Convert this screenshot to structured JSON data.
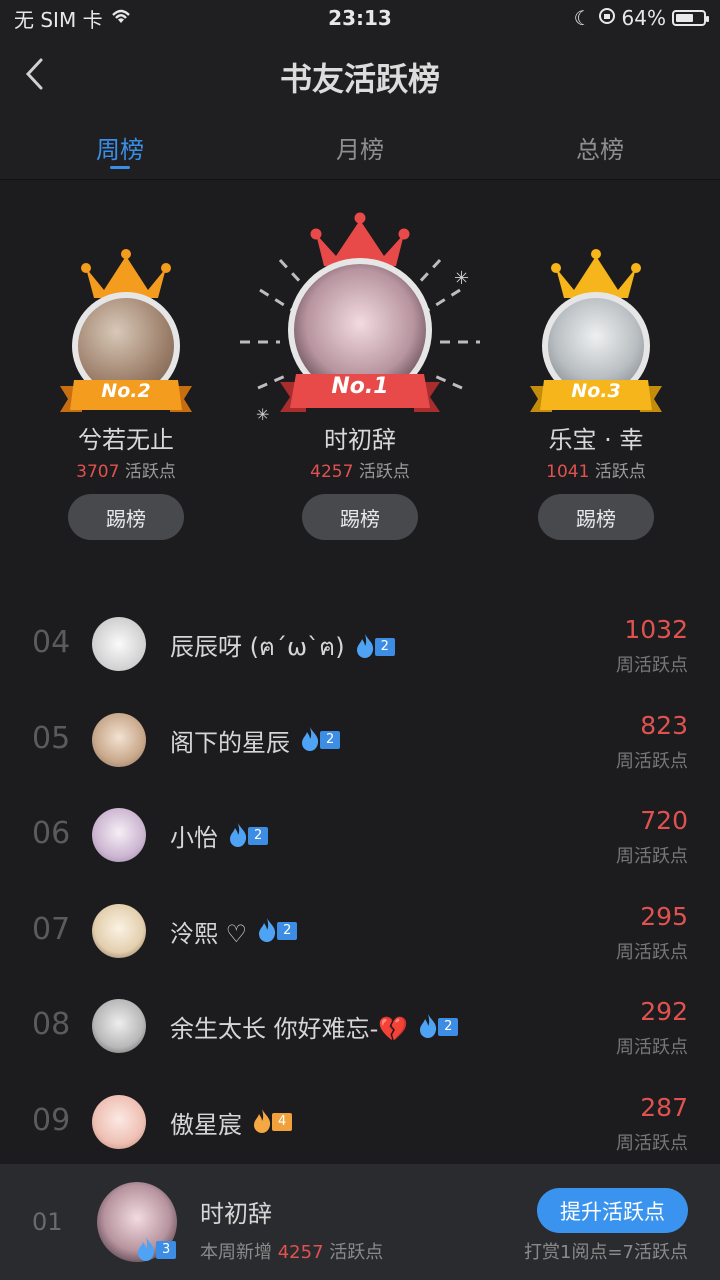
{
  "status_bar": {
    "carrier": "无 SIM 卡",
    "time": "23:13",
    "battery": "64%",
    "battery_level": 0.64
  },
  "nav": {
    "title": "书友活跃榜"
  },
  "tabs": [
    {
      "label": "周榜",
      "active": true
    },
    {
      "label": "月榜",
      "active": false
    },
    {
      "label": "总榜",
      "active": false
    }
  ],
  "podium": {
    "first": {
      "rank_label": "No.1",
      "name": "时初辞",
      "points": "4257",
      "points_unit": "活跃点",
      "button": "踢榜"
    },
    "second": {
      "rank_label": "No.2",
      "name": "兮若无止",
      "points": "3707",
      "points_unit": "活跃点",
      "button": "踢榜"
    },
    "third": {
      "rank_label": "No.3",
      "name": "乐宝 · 幸",
      "points": "1041",
      "points_unit": "活跃点",
      "button": "踢榜"
    }
  },
  "list": [
    {
      "rank": "04",
      "name": "辰辰呀 (ฅ´ω`ฅ)",
      "level": "2",
      "score": "1032",
      "score_label": "周活跃点"
    },
    {
      "rank": "05",
      "name": "阁下的星辰",
      "level": "2",
      "score": "823",
      "score_label": "周活跃点"
    },
    {
      "rank": "06",
      "name": "小怡",
      "level": "2",
      "score": "720",
      "score_label": "周活跃点"
    },
    {
      "rank": "07",
      "name": "泠熙 ♡",
      "level": "2",
      "score": "295",
      "score_label": "周活跃点"
    },
    {
      "rank": "08",
      "name": "余生太长 你好难忘-💔",
      "level": "2",
      "score": "292",
      "score_label": "周活跃点"
    },
    {
      "rank": "09",
      "name": "傲星宸",
      "level": "4",
      "score": "287",
      "score_label": "周活跃点"
    }
  ],
  "me": {
    "rank": "01",
    "name": "时初辞",
    "level": "3",
    "sub_prefix": "本周新增",
    "points": "4257",
    "sub_suffix": "活跃点",
    "boost_button": "提升活跃点",
    "reward_note": "打赏1阅点=7活跃点"
  },
  "colors": {
    "accent": "#3a8ee6",
    "points": "#e0524f",
    "gold": "#f5b51b",
    "red_ribbon": "#e84a4a",
    "orange_ribbon": "#f39c1e"
  }
}
